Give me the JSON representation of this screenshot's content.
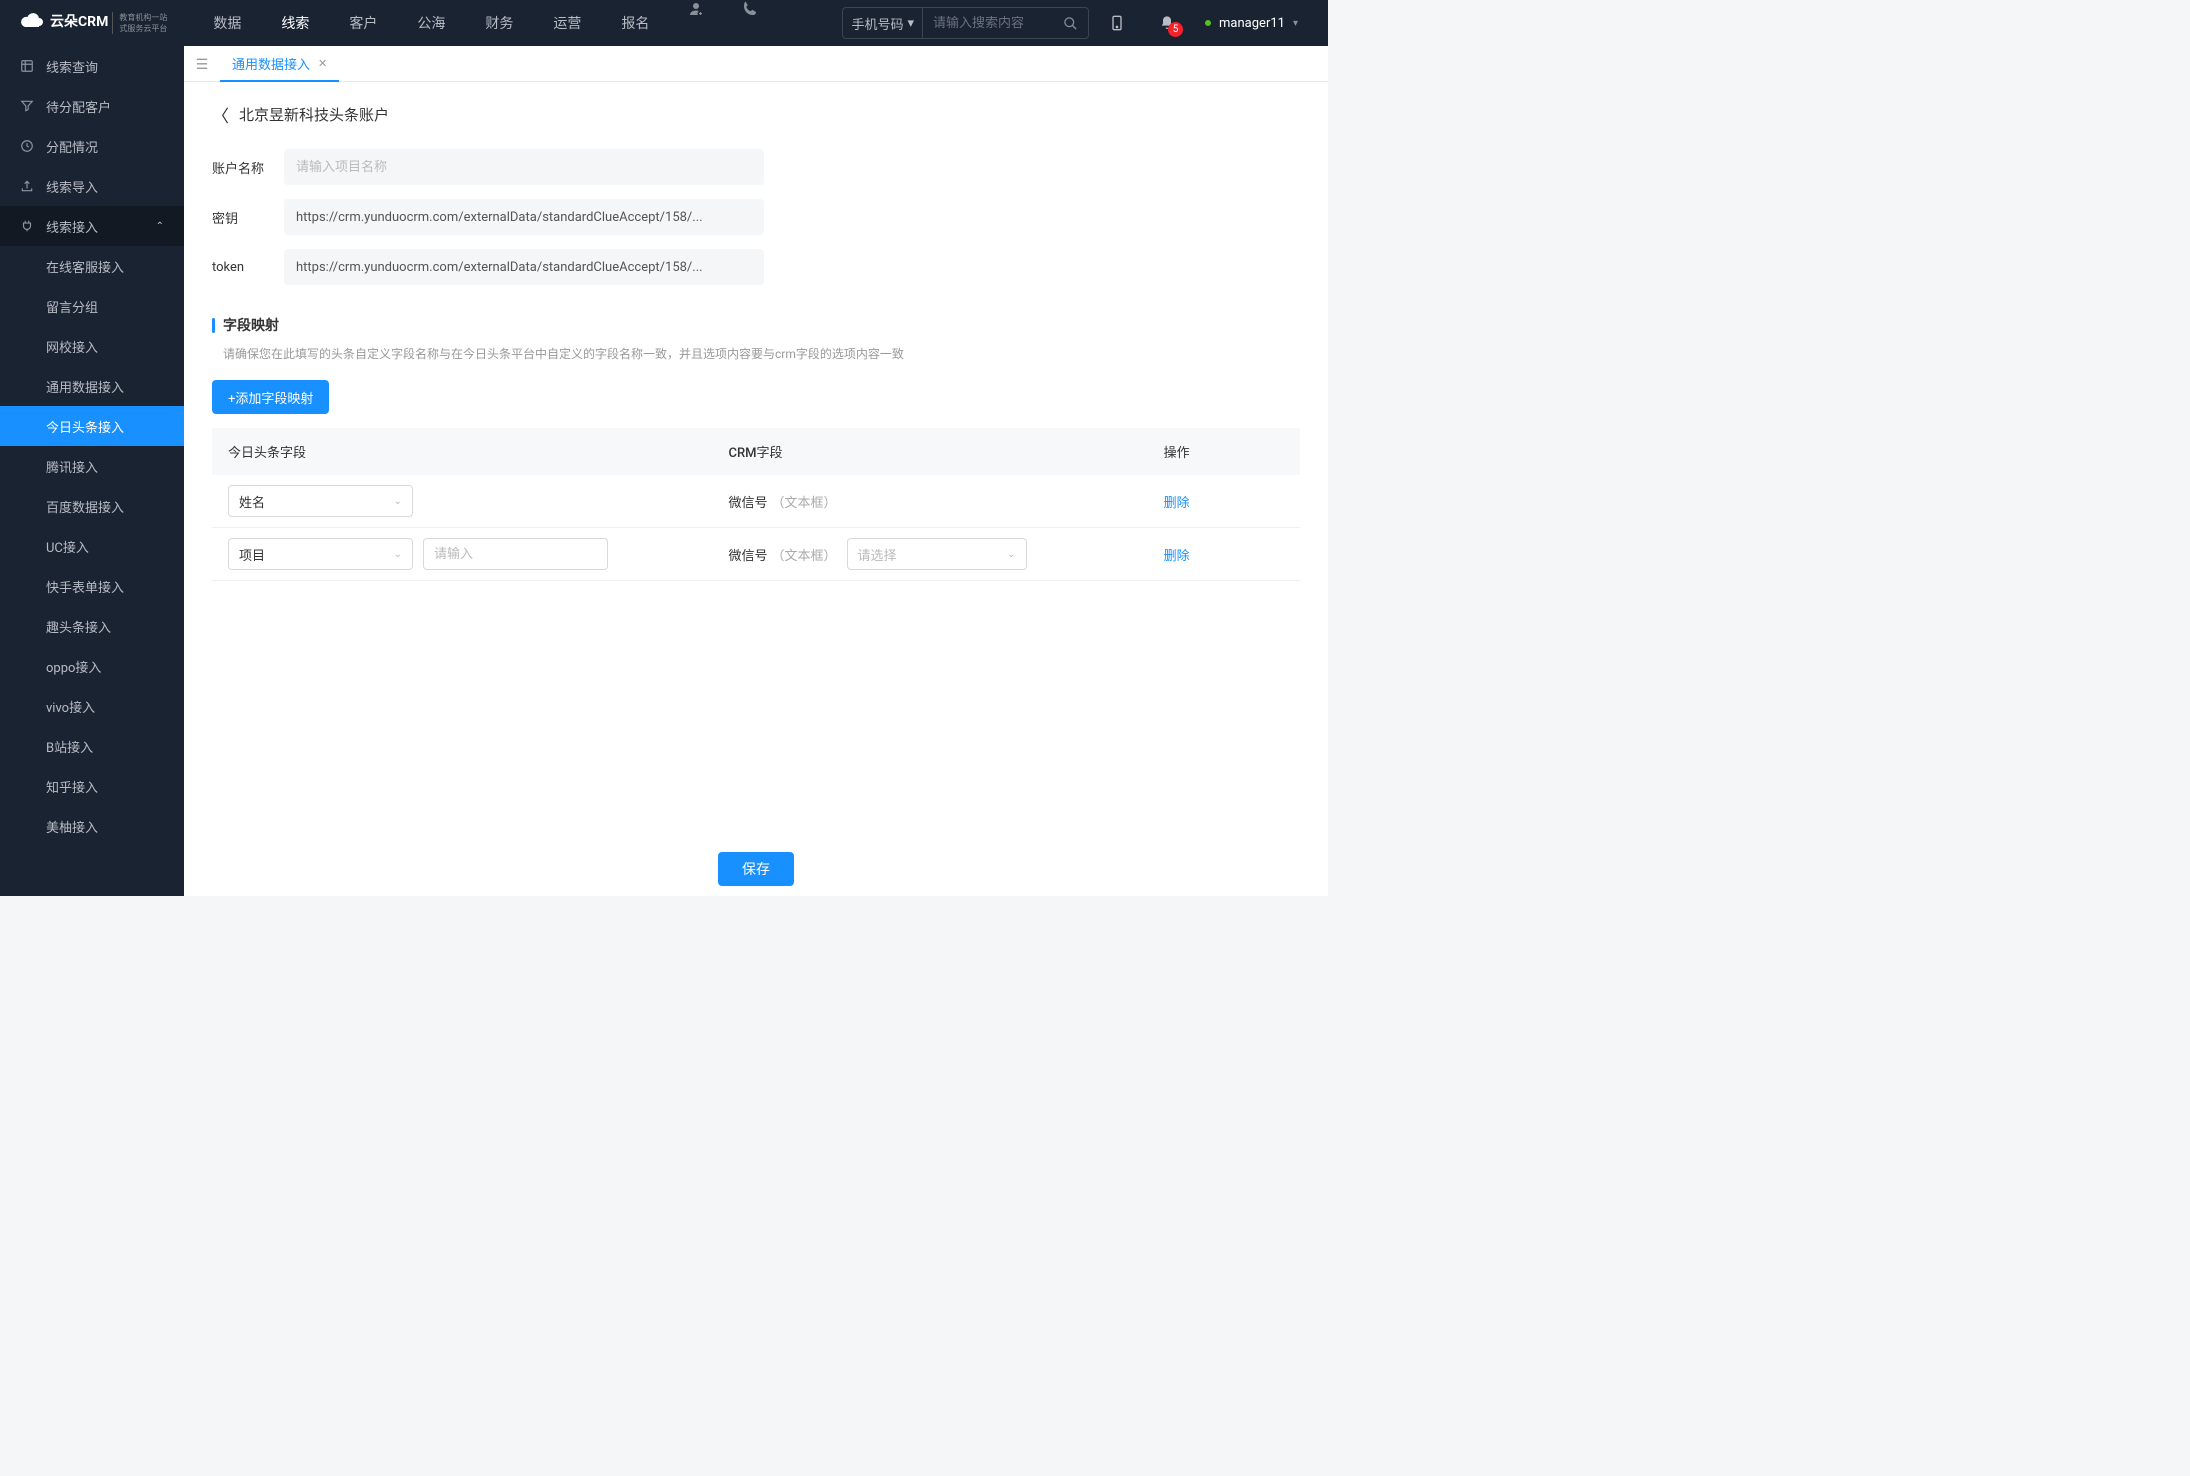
{
  "header": {
    "logo_main": "云朵CRM",
    "logo_sub1": "教育机构一站",
    "logo_sub2": "式服务云平台",
    "nav": [
      "数据",
      "线索",
      "客户",
      "公海",
      "财务",
      "运营",
      "报名"
    ],
    "nav_active_index": 1,
    "search_type": "手机号码",
    "search_placeholder": "请输入搜索内容",
    "badge_count": "5",
    "username": "manager11"
  },
  "sidebar": {
    "items": [
      {
        "label": "线索查询"
      },
      {
        "label": "待分配客户"
      },
      {
        "label": "分配情况"
      },
      {
        "label": "线索导入"
      },
      {
        "label": "线索接入",
        "expanded": true,
        "children": [
          "在线客服接入",
          "留言分组",
          "网校接入",
          "通用数据接入",
          "今日头条接入",
          "腾讯接入",
          "百度数据接入",
          "UC接入",
          "快手表单接入",
          "趣头条接入",
          "oppo接入",
          "vivo接入",
          "B站接入",
          "知乎接入",
          "美柚接入"
        ],
        "active_child_index": 4
      }
    ]
  },
  "tabs": {
    "active_label": "通用数据接入"
  },
  "page": {
    "breadcrumb_title": "北京昱新科技头条账户",
    "fields": {
      "account_label": "账户名称",
      "account_placeholder": "请输入项目名称",
      "account_value": "",
      "secret_label": "密钥",
      "secret_value": "https://crm.yunduocrm.com/externalData/standardClueAccept/158/...",
      "token_label": "token",
      "token_value": "https://crm.yunduocrm.com/externalData/standardClueAccept/158/..."
    },
    "mapping": {
      "title": "字段映射",
      "desc": "请确保您在此填写的头条自定义字段名称与在今日头条平台中自定义的字段名称一致，并且选项内容要与crm字段的选项内容一致",
      "add_button": "+添加字段映射",
      "columns": [
        "今日头条字段",
        "CRM字段",
        "操作"
      ],
      "rows": [
        {
          "tt_field": "姓名",
          "crm_field": "微信号",
          "crm_type": "（文本框）",
          "delete": "删除"
        },
        {
          "tt_field": "项目",
          "tt_input_placeholder": "请输入",
          "crm_field": "微信号",
          "crm_type": "（文本框）",
          "crm_select_placeholder": "请选择",
          "delete": "删除"
        }
      ]
    },
    "save_button": "保存"
  }
}
